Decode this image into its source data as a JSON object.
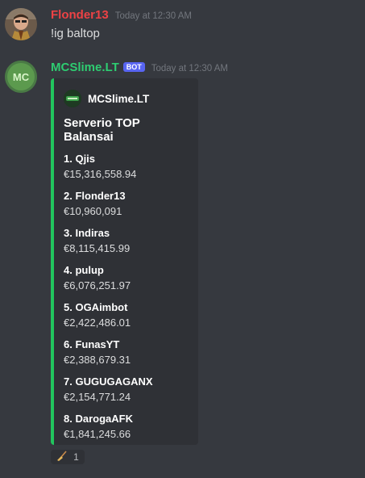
{
  "messages": [
    {
      "username": "Flonder13",
      "username_color": "#ed4245",
      "timestamp": "Today at 12:30 AM",
      "text": "!ig baltop"
    },
    {
      "username": "MCSlime.LT",
      "username_color": "#2ecc71",
      "bot_tag": "BOT",
      "timestamp": "Today at 12:30 AM"
    }
  ],
  "embed": {
    "accent_color": "#22c55e",
    "author": "MCSlime.LT",
    "title": "Serverio TOP Balansai",
    "entries": [
      {
        "name": "1. Qjis",
        "value": "€15,316,558.94"
      },
      {
        "name": "2. Flonder13",
        "value": "€10,960,091"
      },
      {
        "name": "3. Indiras",
        "value": "€8,115,415.99"
      },
      {
        "name": "4. pulup",
        "value": "€6,076,251.97"
      },
      {
        "name": "5. OGAimbot",
        "value": "€2,422,486.01"
      },
      {
        "name": "6. FunasYT",
        "value": "€2,388,679.31"
      },
      {
        "name": "7. GUGUGAGANX",
        "value": "€2,154,771.24"
      },
      {
        "name": "8. DarogaAFK",
        "value": "€1,841,245.66"
      }
    ]
  },
  "reaction": {
    "emoji": "broom",
    "count": "1"
  }
}
